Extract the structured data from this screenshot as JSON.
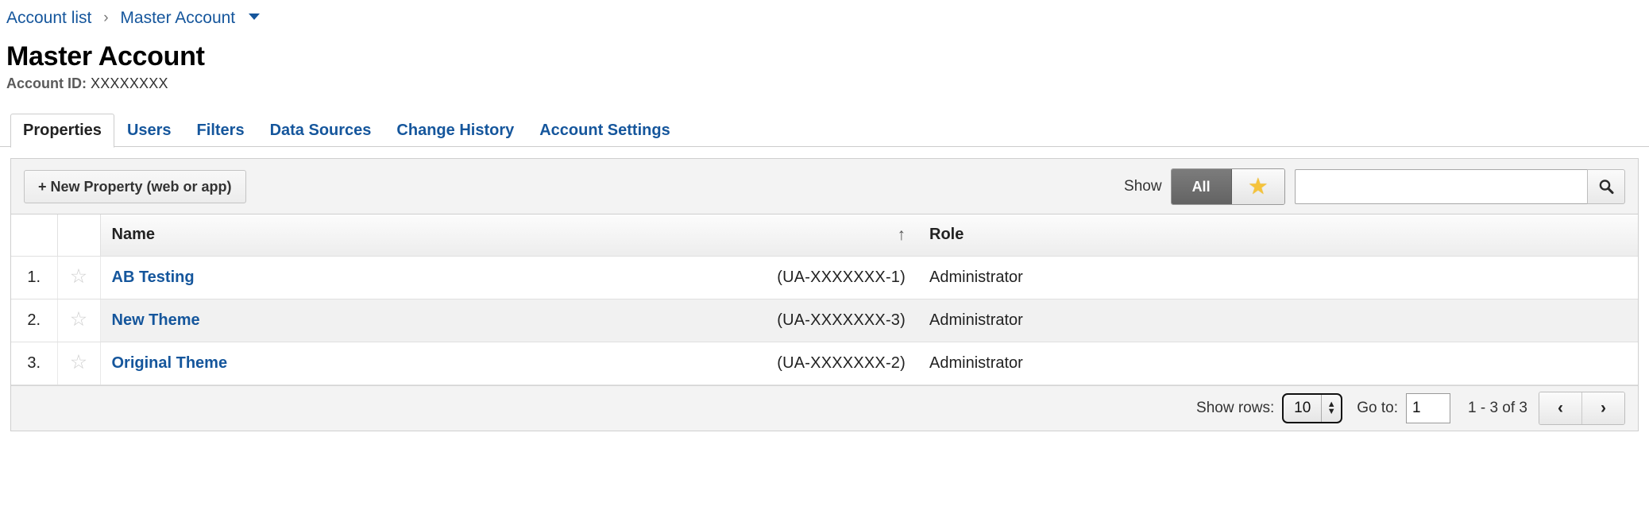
{
  "breadcrumb": {
    "account_list": "Account list",
    "separator": "›",
    "current": "Master Account",
    "caret_icon": "chevron-down-icon"
  },
  "header": {
    "title": "Master Account",
    "account_id_label": "Account ID:",
    "account_id_value": "XXXXXXXX"
  },
  "tabs": [
    {
      "label": "Properties",
      "active": true
    },
    {
      "label": "Users",
      "active": false
    },
    {
      "label": "Filters",
      "active": false
    },
    {
      "label": "Data Sources",
      "active": false
    },
    {
      "label": "Change History",
      "active": false
    },
    {
      "label": "Account Settings",
      "active": false
    }
  ],
  "toolbar": {
    "new_property_label": "+ New Property (web or app)",
    "show_label": "Show",
    "filter_all_label": "All",
    "filter_star_icon": "star-filled-icon",
    "search_value": "",
    "search_placeholder": "",
    "search_icon": "search-icon"
  },
  "table": {
    "columns": [
      "",
      "",
      "Name",
      "Role"
    ],
    "name_header": "Name",
    "role_header": "Role",
    "sort_indicator": "↑",
    "rows": [
      {
        "index": "1.",
        "star_icon": "star-outline-icon",
        "name": "AB Testing",
        "property_id": "(UA-XXXXXXX-1)",
        "role": "Administrator"
      },
      {
        "index": "2.",
        "star_icon": "star-outline-icon",
        "name": "New Theme",
        "property_id": "(UA-XXXXXXX-3)",
        "role": "Administrator"
      },
      {
        "index": "3.",
        "star_icon": "star-outline-icon",
        "name": "Original Theme",
        "property_id": "(UA-XXXXXXX-2)",
        "role": "Administrator"
      }
    ]
  },
  "footer": {
    "show_rows_label": "Show rows:",
    "show_rows_value": "10",
    "goto_label": "Go to:",
    "goto_value": "1",
    "range_text": "1 - 3 of 3",
    "prev_icon": "chevron-left-icon",
    "prev_label": "‹",
    "next_icon": "chevron-right-icon",
    "next_label": "›"
  },
  "colors": {
    "link_blue": "#15569c",
    "star_gold": "#f5c33b",
    "toolbar_bg": "#f3f3f3",
    "active_segment": "#6b6b6b"
  }
}
